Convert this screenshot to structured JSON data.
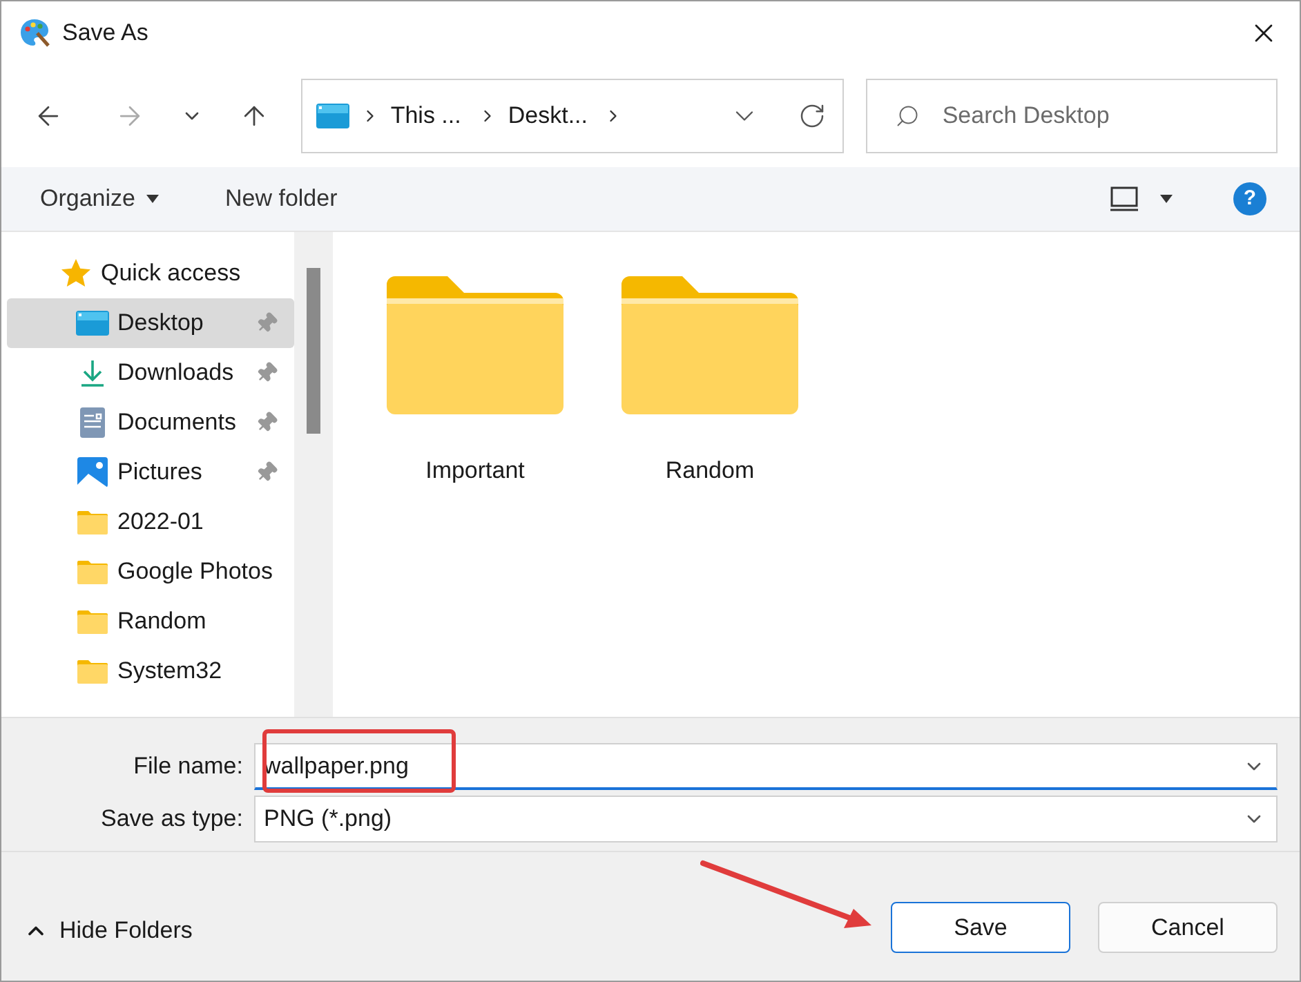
{
  "window": {
    "title": "Save As"
  },
  "nav": {
    "forward": {
      "disabled": true
    },
    "breadcrumb": [
      {
        "label": "This ..."
      },
      {
        "label": "Deskt..."
      }
    ],
    "search": {
      "placeholder": "Search Desktop"
    }
  },
  "toolbar": {
    "organize": "Organize",
    "new_folder": "New folder",
    "help": "?"
  },
  "sidebar": {
    "items": [
      {
        "label": "Quick access",
        "kind": "star",
        "selected": false,
        "children": [
          {
            "label": "Desktop",
            "kind": "desktop",
            "selected": true,
            "pinned": true
          },
          {
            "label": "Downloads",
            "kind": "download",
            "selected": false,
            "pinned": true
          },
          {
            "label": "Documents",
            "kind": "documents",
            "selected": false,
            "pinned": true
          },
          {
            "label": "Pictures",
            "kind": "pictures",
            "selected": false,
            "pinned": true
          },
          {
            "label": "2022-01",
            "kind": "folder",
            "selected": false,
            "pinned": false
          },
          {
            "label": "Google Photos",
            "kind": "folder",
            "selected": false,
            "pinned": false
          },
          {
            "label": "Random",
            "kind": "folder",
            "selected": false,
            "pinned": false
          },
          {
            "label": "System32",
            "kind": "folder",
            "selected": false,
            "pinned": false
          }
        ]
      }
    ]
  },
  "files": [
    {
      "name": "Important"
    },
    {
      "name": "Random"
    }
  ],
  "fields": [
    {
      "label": "File name:",
      "value": "wallpaper.png",
      "focused": true,
      "highlighted": true
    },
    {
      "label": "Save as type:",
      "value": "PNG (*.png)",
      "focused": false,
      "highlighted": false
    }
  ],
  "footer": {
    "hide_folders": "Hide Folders",
    "buttons": [
      {
        "label": "Save",
        "kind": "primary",
        "annotated": true
      },
      {
        "label": "Cancel",
        "kind": "secondary",
        "annotated": false
      }
    ]
  }
}
